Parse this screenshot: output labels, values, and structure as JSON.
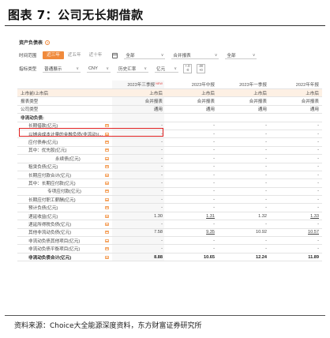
{
  "figure_title": "图表 7：公司无长期借款",
  "source_note": "资料来源：Choice大全能源深度资料，东方财富证券研究所",
  "panel": {
    "title": "资产负债表",
    "help_icon": "?"
  },
  "filters": {
    "time_range_label": "时间范围",
    "time_tabs": [
      "近三年",
      "近五年",
      "近十年"
    ],
    "active_tab": "近三年",
    "period_select": "全部",
    "report_select": "合并报表",
    "quarter_select": "全部",
    "indicator_label": "指标类型",
    "indicator_select": "普通展示",
    "currency_select": "CNY",
    "rate_select": "历史汇率",
    "unit_select": "亿元",
    "precision_top": "+.0",
    "precision_bottom": "-0",
    "precision2_top": ".00",
    "precision2_bottom": "+0"
  },
  "table": {
    "columns": [
      "2023年三季报",
      "2023年中报",
      "2023年一季报",
      "2022年年报"
    ],
    "new_tag": "NEW",
    "rows": [
      {
        "label": "上市前/上市后",
        "values": [
          "上市后",
          "上市后",
          "上市后",
          "上市后"
        ],
        "style": "lined",
        "indent": 0,
        "marker": false
      },
      {
        "label": "报表类型",
        "values": [
          "合并报表",
          "合并报表",
          "合并报表",
          "合并报表"
        ],
        "style": "",
        "indent": 0,
        "marker": false
      },
      {
        "label": "公司类型",
        "values": [
          "通用",
          "通用",
          "通用",
          "通用"
        ],
        "style": "",
        "indent": 0,
        "marker": false
      },
      {
        "label": "非流动负债:",
        "values": [
          "",
          "",
          "",
          ""
        ],
        "style": "section",
        "indent": 0,
        "marker": false
      },
      {
        "label": "长期借款(亿元)",
        "values": [
          "-",
          "-",
          "-",
          "-"
        ],
        "style": "",
        "indent": 1,
        "marker": true
      },
      {
        "label": "以摊余成本计量的金融负债(非流动)(...",
        "values": [
          "-",
          "-",
          "-",
          "-"
        ],
        "style": "",
        "indent": 1,
        "marker": true
      },
      {
        "label": "应付债券(亿元)",
        "values": [
          "-",
          "-",
          "-",
          "-"
        ],
        "style": "",
        "indent": 1,
        "marker": true
      },
      {
        "label": "其中：优先股(亿元)",
        "values": [
          "-",
          "-",
          "-",
          "-"
        ],
        "style": "",
        "indent": 1,
        "marker": true
      },
      {
        "label": "永续债(亿元)",
        "values": [
          "-",
          "-",
          "-",
          "-"
        ],
        "style": "",
        "indent": 3,
        "marker": true
      },
      {
        "label": "租赁负债(亿元)",
        "values": [
          "-",
          "-",
          "-",
          "-"
        ],
        "style": "",
        "indent": 1,
        "marker": true
      },
      {
        "label": "长期应付款合计(亿元)",
        "values": [
          "-",
          "-",
          "-",
          "-"
        ],
        "style": "",
        "indent": 1,
        "marker": true
      },
      {
        "label": "其中：长期应付款(亿元)",
        "values": [
          "-",
          "-",
          "-",
          "-"
        ],
        "style": "",
        "indent": 1,
        "marker": true
      },
      {
        "label": "专项应付款(亿元)",
        "values": [
          "-",
          "-",
          "-",
          "-"
        ],
        "style": "",
        "indent": 2,
        "marker": true
      },
      {
        "label": "长期应付职工薪酬(亿元)",
        "values": [
          "-",
          "-",
          "-",
          "-"
        ],
        "style": "",
        "indent": 1,
        "marker": true
      },
      {
        "label": "预计负债(亿元)",
        "values": [
          "-",
          "-",
          "-",
          "-"
        ],
        "style": "",
        "indent": 1,
        "marker": true
      },
      {
        "label": "递延收益(亿元)",
        "values": [
          "1.30",
          "1.31",
          "1.32",
          "1.33"
        ],
        "style": "",
        "indent": 1,
        "marker": true,
        "underline": [
          false,
          true,
          false,
          true
        ]
      },
      {
        "label": "递延所得税负债(亿元)",
        "values": [
          "-",
          "-",
          "-",
          "-"
        ],
        "style": "",
        "indent": 1,
        "marker": true
      },
      {
        "label": "其他非流动负债(亿元)",
        "values": [
          "7.58",
          "9.35",
          "10.92",
          "10.57"
        ],
        "style": "",
        "indent": 1,
        "marker": true,
        "underline": [
          false,
          true,
          false,
          true
        ]
      },
      {
        "label": "非流动负债其他项目(亿元)",
        "values": [
          "-",
          "-",
          "-",
          "-"
        ],
        "style": "",
        "indent": 1,
        "marker": true
      },
      {
        "label": "非流动负债平衡项目(亿元)",
        "values": [
          "-",
          "-",
          "-",
          "-"
        ],
        "style": "",
        "indent": 1,
        "marker": true
      },
      {
        "label": "非流动负债合计(亿元)",
        "values": [
          "8.88",
          "10.65",
          "12.24",
          "11.89"
        ],
        "style": "bold",
        "indent": 1,
        "marker": true
      }
    ]
  }
}
